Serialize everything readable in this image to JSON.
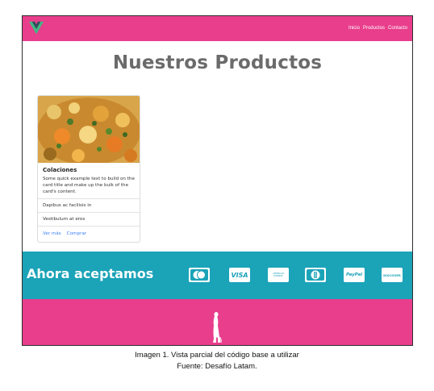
{
  "navbar": {
    "links": [
      "Inicio",
      "Productos",
      "Contacto"
    ],
    "bg_color": "#e83e8c",
    "logo_icon": "vue-logo-icon"
  },
  "main": {
    "title": "Nuestros Productos"
  },
  "card": {
    "image_icon": "food-photo",
    "title": "Colaciones",
    "text": "Some quick example text to build on the card title and make up the bulk of the card's content.",
    "list_items": [
      "Dapibus ac facilisis in",
      "Vestibulum at eros"
    ],
    "links": [
      "Ver más",
      "Comprar"
    ]
  },
  "payment": {
    "title": "Ahora aceptamos",
    "bg_color": "#1ba3b8",
    "icons": [
      "mastercard-icon",
      "visa-icon",
      "american-express-icon",
      "diners-club-icon",
      "paypal-icon",
      "discover-icon"
    ],
    "icon_labels": {
      "visa": "VISA",
      "amex": "AMERICAN EXPRESS",
      "paypal": "PayPal",
      "discover": "DISCOVER"
    }
  },
  "footer": {
    "bg_color": "#e83e8c",
    "icon": "meerkat-icon"
  },
  "caption": {
    "line1": "Imagen 1. Vista parcial del código base a utilizar",
    "line2": "Fuente: Desafío Latam."
  }
}
